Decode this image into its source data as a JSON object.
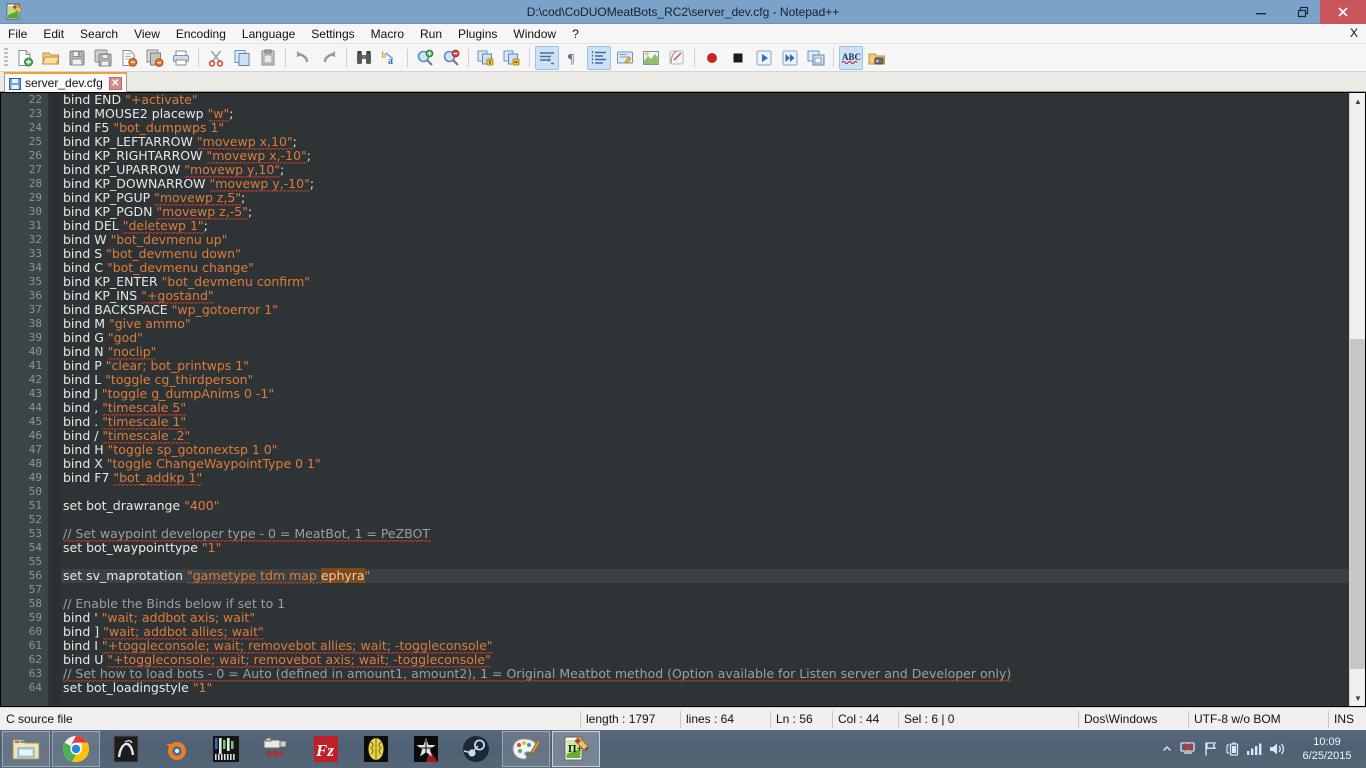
{
  "window": {
    "title": "D:\\cod\\CoDUOMeatBots_RC2\\server_dev.cfg - Notepad++",
    "app_icon": "notepadpp-icon",
    "minimize_label": "–",
    "maximize_label": "❐",
    "close_label": "✕",
    "accent_titlebar": "#7ba2c9",
    "close_color": "#c9555c"
  },
  "menubar": {
    "items": [
      {
        "label": "File"
      },
      {
        "label": "Edit"
      },
      {
        "label": "Search"
      },
      {
        "label": "View"
      },
      {
        "label": "Encoding"
      },
      {
        "label": "Language"
      },
      {
        "label": "Settings"
      },
      {
        "label": "Macro"
      },
      {
        "label": "Run"
      },
      {
        "label": "Plugins"
      },
      {
        "label": "Window"
      },
      {
        "label": "?"
      }
    ],
    "right_label": "X"
  },
  "toolbar": {
    "buttons": [
      {
        "name": "new-file",
        "icon": "new-document-icon"
      },
      {
        "name": "open-file",
        "icon": "open-folder-icon"
      },
      {
        "name": "save-file",
        "icon": "floppy-disk-icon"
      },
      {
        "name": "save-all",
        "icon": "save-all-icon"
      },
      {
        "name": "close-file",
        "icon": "close-document-icon"
      },
      {
        "name": "close-all",
        "icon": "close-all-documents-icon"
      },
      {
        "name": "print",
        "icon": "printer-icon"
      },
      {
        "name": "sep1",
        "icon": "separator"
      },
      {
        "name": "cut",
        "icon": "scissors-icon"
      },
      {
        "name": "copy",
        "icon": "copy-icon"
      },
      {
        "name": "paste",
        "icon": "paste-icon"
      },
      {
        "name": "sep2",
        "icon": "separator"
      },
      {
        "name": "undo",
        "icon": "undo-arrow-icon"
      },
      {
        "name": "redo",
        "icon": "redo-arrow-icon"
      },
      {
        "name": "sep3",
        "icon": "separator"
      },
      {
        "name": "find",
        "icon": "binoculars-icon"
      },
      {
        "name": "replace",
        "icon": "replace-icon"
      },
      {
        "name": "sep4",
        "icon": "separator"
      },
      {
        "name": "zoom-in",
        "icon": "magnifier-plus-icon"
      },
      {
        "name": "zoom-out",
        "icon": "magnifier-minus-icon"
      },
      {
        "name": "sep5",
        "icon": "separator"
      },
      {
        "name": "sync-vertical-scroll",
        "icon": "sync-scroll-vertical-icon"
      },
      {
        "name": "sync-horizontal-scroll",
        "icon": "sync-scroll-horizontal-icon"
      },
      {
        "name": "sep6",
        "icon": "separator"
      },
      {
        "name": "word-wrap",
        "icon": "word-wrap-icon"
      },
      {
        "name": "show-all-characters",
        "icon": "pilcrow-icon"
      },
      {
        "name": "show-indent-guide",
        "icon": "indent-guide-icon"
      },
      {
        "name": "user-defined-dialog",
        "icon": "user-language-icon"
      },
      {
        "name": "show-document-map",
        "icon": "document-map-icon"
      },
      {
        "name": "show-function-list",
        "icon": "function-list-icon"
      },
      {
        "name": "sep7",
        "icon": "separator"
      },
      {
        "name": "start-recording",
        "icon": "record-icon"
      },
      {
        "name": "stop-recording",
        "icon": "stop-icon"
      },
      {
        "name": "play-macro",
        "icon": "play-icon"
      },
      {
        "name": "run-macro-multiple",
        "icon": "fast-forward-icon"
      },
      {
        "name": "save-macro",
        "icon": "save-macro-icon"
      },
      {
        "name": "sep8",
        "icon": "separator"
      },
      {
        "name": "spell-check",
        "icon": "abc-spellcheck-icon"
      },
      {
        "name": "run",
        "icon": "run-console-icon"
      }
    ],
    "active_buttons": [
      "word-wrap",
      "show-indent-guide",
      "spell-check"
    ]
  },
  "tabs": [
    {
      "label": "server_dev.cfg",
      "icon": "saved-floppy-icon",
      "close": "✕",
      "active": true
    }
  ],
  "editor": {
    "first_line": 22,
    "current_line": 56,
    "selection_text": "ephyra",
    "lines": [
      {
        "n": 22,
        "tokens": [
          {
            "t": "bind END ",
            "c": "kw"
          },
          {
            "t": "\"+activate\"",
            "c": "str"
          }
        ]
      },
      {
        "n": 23,
        "tokens": [
          {
            "t": "bind MOUSE2 placewp ",
            "c": "kw"
          },
          {
            "t": "\"w\"",
            "c": "str sp"
          },
          {
            "t": ";",
            "c": "kw"
          }
        ]
      },
      {
        "n": 24,
        "tokens": [
          {
            "t": "bind F5 ",
            "c": "kw"
          },
          {
            "t": "\"bot_dumpwps 1\"",
            "c": "str"
          }
        ]
      },
      {
        "n": 25,
        "tokens": [
          {
            "t": "bind KP_LEFTARROW ",
            "c": "kw"
          },
          {
            "t": "\"movewp x,10\"",
            "c": "str sp"
          },
          {
            "t": ";",
            "c": "kw"
          }
        ]
      },
      {
        "n": 26,
        "tokens": [
          {
            "t": "bind KP_RIGHTARROW ",
            "c": "kw"
          },
          {
            "t": "\"movewp x,-10\"",
            "c": "str sp"
          },
          {
            "t": ";",
            "c": "kw"
          }
        ]
      },
      {
        "n": 27,
        "tokens": [
          {
            "t": "bind KP_UPARROW ",
            "c": "kw"
          },
          {
            "t": "\"movewp y,10\"",
            "c": "str sp"
          },
          {
            "t": ";",
            "c": "kw"
          }
        ]
      },
      {
        "n": 28,
        "tokens": [
          {
            "t": "bind KP_DOWNARROW ",
            "c": "kw"
          },
          {
            "t": "\"movewp y,-10\"",
            "c": "str sp"
          },
          {
            "t": ";",
            "c": "kw"
          }
        ]
      },
      {
        "n": 29,
        "tokens": [
          {
            "t": "bind KP_PGUP ",
            "c": "kw"
          },
          {
            "t": "\"movewp z,5\"",
            "c": "str sp"
          },
          {
            "t": ";",
            "c": "kw"
          }
        ]
      },
      {
        "n": 30,
        "tokens": [
          {
            "t": "bind KP_PGDN ",
            "c": "kw"
          },
          {
            "t": "\"movewp z,-5\"",
            "c": "str sp"
          },
          {
            "t": ";",
            "c": "kw"
          }
        ]
      },
      {
        "n": 31,
        "tokens": [
          {
            "t": "bind DEL ",
            "c": "kw"
          },
          {
            "t": "\"deletewp 1\"",
            "c": "str sp"
          },
          {
            "t": ";",
            "c": "kw"
          }
        ]
      },
      {
        "n": 32,
        "tokens": [
          {
            "t": "bind W ",
            "c": "kw"
          },
          {
            "t": "\"bot_devmenu up\"",
            "c": "str"
          }
        ]
      },
      {
        "n": 33,
        "tokens": [
          {
            "t": "bind S ",
            "c": "kw"
          },
          {
            "t": "\"bot_devmenu down\"",
            "c": "str"
          }
        ]
      },
      {
        "n": 34,
        "tokens": [
          {
            "t": "bind C ",
            "c": "kw"
          },
          {
            "t": "\"bot_devmenu change\"",
            "c": "str"
          }
        ]
      },
      {
        "n": 35,
        "tokens": [
          {
            "t": "bind KP_ENTER ",
            "c": "kw"
          },
          {
            "t": "\"bot_devmenu confirm\"",
            "c": "str"
          }
        ]
      },
      {
        "n": 36,
        "tokens": [
          {
            "t": "bind KP_INS ",
            "c": "kw"
          },
          {
            "t": "\"+gostand\"",
            "c": "str sp"
          }
        ]
      },
      {
        "n": 37,
        "tokens": [
          {
            "t": "bind BACKSPACE ",
            "c": "kw"
          },
          {
            "t": "\"wp_gotoerror 1\"",
            "c": "str"
          }
        ]
      },
      {
        "n": 38,
        "tokens": [
          {
            "t": "bind M ",
            "c": "kw"
          },
          {
            "t": "\"give ammo\"",
            "c": "str"
          }
        ]
      },
      {
        "n": 39,
        "tokens": [
          {
            "t": "bind G ",
            "c": "kw"
          },
          {
            "t": "\"god\"",
            "c": "str"
          }
        ]
      },
      {
        "n": 40,
        "tokens": [
          {
            "t": "bind N ",
            "c": "kw"
          },
          {
            "t": "\"noclip\"",
            "c": "str sp"
          }
        ]
      },
      {
        "n": 41,
        "tokens": [
          {
            "t": "bind P ",
            "c": "kw"
          },
          {
            "t": "\"clear; bot_printwps 1\"",
            "c": "str"
          }
        ]
      },
      {
        "n": 42,
        "tokens": [
          {
            "t": "bind L ",
            "c": "kw"
          },
          {
            "t": "\"toggle cg_thirdperson\"",
            "c": "str"
          }
        ]
      },
      {
        "n": 43,
        "tokens": [
          {
            "t": "bind J ",
            "c": "kw"
          },
          {
            "t": "\"toggle g_dumpAnims 0 -1\"",
            "c": "str"
          }
        ]
      },
      {
        "n": 44,
        "tokens": [
          {
            "t": "bind , ",
            "c": "kw"
          },
          {
            "t": "\"timescale 5\"",
            "c": "str sp"
          }
        ]
      },
      {
        "n": 45,
        "tokens": [
          {
            "t": "bind . ",
            "c": "kw"
          },
          {
            "t": "\"timescale 1\"",
            "c": "str sp"
          }
        ]
      },
      {
        "n": 46,
        "tokens": [
          {
            "t": "bind / ",
            "c": "kw"
          },
          {
            "t": "\"timescale .2\"",
            "c": "str sp"
          }
        ]
      },
      {
        "n": 47,
        "tokens": [
          {
            "t": "bind H ",
            "c": "kw"
          },
          {
            "t": "\"toggle sp_gotonextsp 1 0\"",
            "c": "str"
          }
        ]
      },
      {
        "n": 48,
        "tokens": [
          {
            "t": "bind X ",
            "c": "kw"
          },
          {
            "t": "\"toggle ChangeWaypointType 0 1\"",
            "c": "str"
          }
        ]
      },
      {
        "n": 49,
        "tokens": [
          {
            "t": "bind F7 ",
            "c": "kw"
          },
          {
            "t": "\"bot_addkp 1\"",
            "c": "str sp"
          }
        ]
      },
      {
        "n": 50,
        "tokens": []
      },
      {
        "n": 51,
        "tokens": [
          {
            "t": "set bot_drawrange ",
            "c": "kw"
          },
          {
            "t": "\"400\"",
            "c": "str"
          }
        ]
      },
      {
        "n": 52,
        "tokens": []
      },
      {
        "n": 53,
        "tokens": [
          {
            "t": "// Set waypoint developer type - 0 = MeatBot, 1 = PeZBOT",
            "c": "cmt sp"
          }
        ]
      },
      {
        "n": 54,
        "tokens": [
          {
            "t": "set bot_waypointtype ",
            "c": "kw"
          },
          {
            "t": "\"1\"",
            "c": "str"
          }
        ]
      },
      {
        "n": 55,
        "tokens": []
      },
      {
        "n": 56,
        "tokens": [
          {
            "t": "set sv_maprotation ",
            "c": "kw"
          },
          {
            "t": "\"gametype tdm map ",
            "c": "str sp"
          },
          {
            "t": "ephyra",
            "c": "str sel"
          },
          {
            "t": "\"",
            "c": "str"
          }
        ],
        "current": true
      },
      {
        "n": 57,
        "tokens": []
      },
      {
        "n": 58,
        "tokens": [
          {
            "t": "// Enable the Binds below if set to 1",
            "c": "cmt"
          }
        ]
      },
      {
        "n": 59,
        "tokens": [
          {
            "t": "bind ' ",
            "c": "kw"
          },
          {
            "t": "\"wait; addbot axis; wait\"",
            "c": "str"
          }
        ]
      },
      {
        "n": 60,
        "tokens": [
          {
            "t": "bind ] ",
            "c": "kw"
          },
          {
            "t": "\"wait; addbot allies; wait\"",
            "c": "str sp"
          }
        ]
      },
      {
        "n": 61,
        "tokens": [
          {
            "t": "bind I ",
            "c": "kw"
          },
          {
            "t": "\"+toggleconsole; wait; removebot allies; wait; -toggleconsole\"",
            "c": "str sp"
          }
        ]
      },
      {
        "n": 62,
        "tokens": [
          {
            "t": "bind U ",
            "c": "kw"
          },
          {
            "t": "\"+toggleconsole; wait; removebot axis; wait; -toggleconsole\"",
            "c": "str sp"
          }
        ]
      },
      {
        "n": 63,
        "tokens": [
          {
            "t": "// Set how to load bots - 0 = Auto (defined in amount1, amount2), 1 = Original Meatbot method (Option available for Listen server and Developer only)",
            "c": "cmt sp"
          }
        ]
      },
      {
        "n": 64,
        "tokens": [
          {
            "t": "set bot_loadingstyle ",
            "c": "kw"
          },
          {
            "t": "\"1\"",
            "c": "str"
          }
        ]
      }
    ]
  },
  "statusbar": {
    "file_type": "C source file",
    "length_label": "length : 1797",
    "lines_label": "lines : 64",
    "ln_label": "Ln : 56",
    "col_label": "Col : 44",
    "sel_label": "Sel : 6 | 0",
    "eol": "Dos\\Windows",
    "encoding": "UTF-8 w/o BOM",
    "insert_mode": "INS"
  },
  "taskbar": {
    "items": [
      {
        "name": "file-explorer",
        "icon": "folder-icon",
        "state": "open"
      },
      {
        "name": "google-chrome",
        "icon": "chrome-icon",
        "state": "open"
      },
      {
        "name": "maya",
        "icon": "maya-icon",
        "state": "pinned"
      },
      {
        "name": "blender",
        "icon": "blender-icon",
        "state": "pinned"
      },
      {
        "name": "audio-editor",
        "icon": "audio-mixer-icon",
        "state": "pinned"
      },
      {
        "name": "radiant-editor",
        "icon": "radiant-icon",
        "state": "pinned"
      },
      {
        "name": "filezilla",
        "icon": "filezilla-icon",
        "state": "pinned"
      },
      {
        "name": "brain-app",
        "icon": "brain-icon",
        "state": "pinned"
      },
      {
        "name": "call-of-duty",
        "icon": "cod-star-icon",
        "state": "pinned"
      },
      {
        "name": "steam",
        "icon": "steam-icon",
        "state": "pinned"
      },
      {
        "name": "paint",
        "icon": "paint-palette-icon",
        "state": "open"
      },
      {
        "name": "notepad-plus-plus",
        "icon": "notepadpp-icon",
        "state": "focus"
      }
    ],
    "tray": [
      {
        "name": "show-hidden-icons",
        "icon": "chevron-up-icon"
      },
      {
        "name": "network-disconnected",
        "icon": "network-error-icon"
      },
      {
        "name": "action-center",
        "icon": "flag-icon"
      },
      {
        "name": "battery",
        "icon": "battery-icon"
      },
      {
        "name": "signal",
        "icon": "signal-bars-icon"
      },
      {
        "name": "volume",
        "icon": "speaker-icon"
      }
    ],
    "clock_time": "10:09",
    "clock_date": "6/25/2015"
  }
}
